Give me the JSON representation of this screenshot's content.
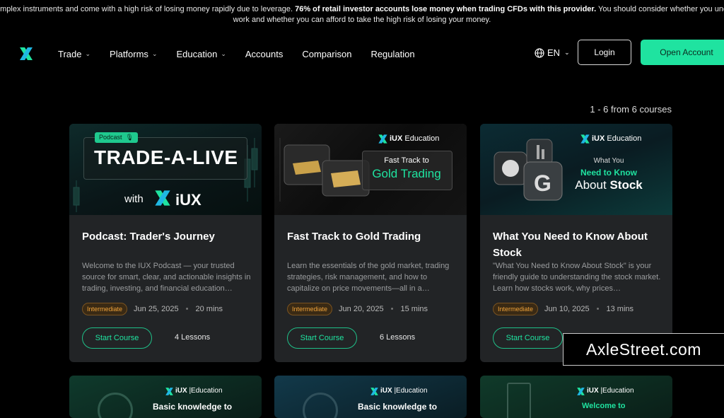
{
  "risk_banner": {
    "line1_start": "omplex instruments and come with a high risk of losing money rapidly due to leverage.",
    "line1_bold": "76% of retail investor accounts lose money when trading CFDs with this provider.",
    "line1_end": "You should consider whether you under",
    "line2": "work and whether you can afford to take the high risk of losing your money."
  },
  "nav": {
    "items": [
      {
        "label": "Trade",
        "has_dropdown": true
      },
      {
        "label": "Platforms",
        "has_dropdown": true
      },
      {
        "label": "Education",
        "has_dropdown": true
      },
      {
        "label": "Accounts",
        "has_dropdown": false
      },
      {
        "label": "Comparison",
        "has_dropdown": false
      },
      {
        "label": "Regulation",
        "has_dropdown": false
      }
    ],
    "language": "EN",
    "login": "Login",
    "open_account": "Open Account"
  },
  "course_count": "1 - 6 from 6 courses",
  "colors": {
    "accent": "#1fe3a0",
    "card_bg": "#222426",
    "level_badge": "#f0a33a"
  },
  "courses": [
    {
      "thumb": {
        "badge": "Podcast",
        "headline": "TRADE-A-LIVE",
        "with": "with",
        "brand": "iUX"
      },
      "title": "Podcast: Trader's Journey",
      "description": "Welcome to the IUX Podcast — your trusted source for smart, clear, and actionable insights in trading, investing, and financial education…",
      "level": "Intermediate",
      "date": "Jun 25, 2025",
      "duration": "20 mins",
      "cta": "Start Course",
      "lessons": "4 Lessons"
    },
    {
      "thumb": {
        "brand": "iUX",
        "brand_sub": "Education",
        "line1": "Fast Track to",
        "line2": "Gold Trading"
      },
      "title": "Fast Track to Gold Trading",
      "description": "Learn the essentials of the gold market, trading strategies, risk management, and how to capitalize on price movements—all in a…",
      "level": "Intermediate",
      "date": "Jun 20, 2025",
      "duration": "15 mins",
      "cta": "Start Course",
      "lessons": "6 Lessons"
    },
    {
      "thumb": {
        "brand": "iUX",
        "brand_sub": "Education",
        "line1": "What You",
        "line2": "Need to Know",
        "line3_a": "About",
        "line3_b": "Stock"
      },
      "title": "What You Need to Know About Stock",
      "description": "\"What You Need to Know About Stock\" is your friendly guide to understanding the stock market. Learn how stocks work, why prices…",
      "level": "Intermediate",
      "date": "Jun 10, 2025",
      "duration": "13 mins",
      "cta": "Start Course",
      "lessons": ""
    }
  ],
  "courses_row2": [
    {
      "brand": "iUX",
      "brand_sub": "|Education",
      "line1": "Basic knowledge to"
    },
    {
      "brand": "iUX",
      "brand_sub": "|Education",
      "line1": "Basic knowledge to"
    },
    {
      "brand": "iUX",
      "brand_sub": "|Education",
      "line1": "Welcome to"
    }
  ],
  "watermark": "AxleStreet.com"
}
